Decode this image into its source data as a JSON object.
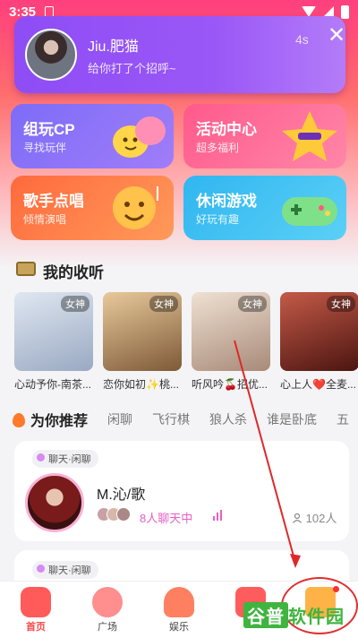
{
  "status_bar": {
    "time": "3:35"
  },
  "notification": {
    "name": "Jiu.肥猫",
    "message": "给你打了个招呼~",
    "time": "4s",
    "close": "✕"
  },
  "features": [
    {
      "title": "组玩CP",
      "subtitle": "寻找玩伴"
    },
    {
      "title": "活动中心",
      "subtitle": "超多福利"
    },
    {
      "title": "歌手点唱",
      "subtitle": "倾情演唱"
    },
    {
      "title": "休闲游戏",
      "subtitle": "好玩有趣"
    }
  ],
  "my_listen": {
    "title": "我的收听",
    "items": [
      {
        "name": "心动予你-南茶...",
        "tag": "女神",
        "cover_color": "#b9c7d8"
      },
      {
        "name": "恋你如初✨桃...",
        "tag": "女神",
        "cover_color": "#c29a6e"
      },
      {
        "name": "听风吟🍒招优...",
        "tag": "女神",
        "cover_color": "#d6c3b3"
      },
      {
        "name": "心上人❤️全麦...",
        "tag": "女神",
        "cover_color": "#8a3a2e"
      }
    ]
  },
  "tabs": [
    "为你推荐",
    "闲聊",
    "飞行棋",
    "狼人杀",
    "谁是卧底",
    "五"
  ],
  "rooms": [
    {
      "tag": "聊天·闲聊",
      "title": "M.沁/歌",
      "chatting": "8人聊天中",
      "people": "102人"
    },
    {
      "tag": "聊天·闲聊"
    }
  ],
  "bottom_nav": [
    {
      "label": "首页"
    },
    {
      "label": "广场"
    },
    {
      "label": "娱乐"
    },
    {
      "label": ""
    },
    {
      "label": ""
    }
  ],
  "watermark": {
    "part1": "谷普",
    "part2": "软件园"
  }
}
